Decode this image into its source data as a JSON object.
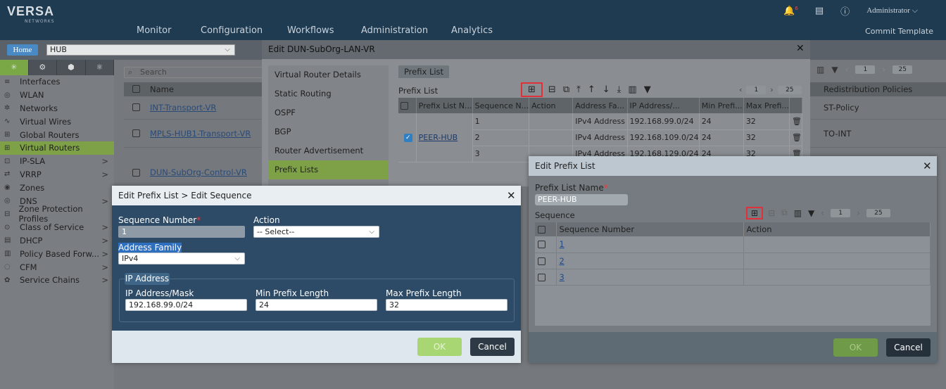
{
  "app": {
    "logo": "VERSA",
    "logo_sub": "NETWORKS",
    "nav": [
      "Monitor",
      "Configuration",
      "Workflows",
      "Administration",
      "Analytics"
    ],
    "user": "Administrator",
    "commit": "Commit Template",
    "badge": "6"
  },
  "context": {
    "home": "Home",
    "org": "HUB"
  },
  "left_nav": [
    {
      "label": "Interfaces",
      "icon": "≡",
      "arrow": ""
    },
    {
      "label": "WLAN",
      "icon": "◎",
      "arrow": ""
    },
    {
      "label": "Networks",
      "icon": "✲",
      "arrow": ""
    },
    {
      "label": "Virtual Wires",
      "icon": "∿",
      "arrow": ""
    },
    {
      "label": "Global Routers",
      "icon": "⊞",
      "arrow": ""
    },
    {
      "label": "Virtual Routers",
      "icon": "⊞",
      "arrow": "",
      "selected": true
    },
    {
      "label": "IP-SLA",
      "icon": "⊡",
      "arrow": ">"
    },
    {
      "label": "VRRP",
      "icon": "⇄",
      "arrow": ">"
    },
    {
      "label": "Zones",
      "icon": "◉",
      "arrow": ""
    },
    {
      "label": "DNS",
      "icon": "◎",
      "arrow": ">"
    },
    {
      "label": "Zone Protection Profiles",
      "icon": "⊟",
      "arrow": ""
    },
    {
      "label": "Class of Service",
      "icon": "⊙",
      "arrow": ">"
    },
    {
      "label": "DHCP",
      "icon": "▤",
      "arrow": ">"
    },
    {
      "label": "Policy Based Forw...",
      "icon": "▥",
      "arrow": ">"
    },
    {
      "label": "CFM",
      "icon": "◌",
      "arrow": ">"
    },
    {
      "label": "Service Chains",
      "icon": "✿",
      "arrow": ">"
    }
  ],
  "list": {
    "search_placeholder": "Search",
    "col_name": "Name",
    "col_redist": "Redistribution Policies",
    "rows": [
      {
        "name": "INT-Transport-VR",
        "redist": "ST-Policy"
      },
      {
        "name": "MPLS-HUB1-Transport-VR",
        "redist": "TO-INT"
      },
      {
        "name": "DUN-SubOrg-Control-VR",
        "redist": ""
      }
    ],
    "page": "1",
    "page_size": "25"
  },
  "vr_dialog": {
    "title": "Edit DUN-SubOrg-LAN-VR",
    "menu": [
      "Virtual Router Details",
      "Static Routing",
      "OSPF",
      "BGP",
      "Router Advertisement",
      "Prefix Lists"
    ],
    "tab": "Prefix List",
    "section": "Prefix List",
    "page": "1",
    "page_size": "25",
    "columns": [
      "Prefix List N...",
      "Sequence N...",
      "Action",
      "Address Fa...",
      "IP Address/...",
      "Min Prefi...",
      "Max Prefi..."
    ],
    "rows": [
      {
        "name": "",
        "seq": "1",
        "action": "",
        "family": "IPv4 Address",
        "ip": "192.168.99.0/24",
        "min": "24",
        "max": "32"
      },
      {
        "name": "PEER-HUB",
        "seq": "2",
        "action": "",
        "family": "IPv4 Address",
        "ip": "192.168.109.0/24",
        "min": "24",
        "max": "32"
      },
      {
        "name": "",
        "seq": "3",
        "action": "",
        "family": "IPv4 Address",
        "ip": "192.168.129.0/24",
        "min": "24",
        "max": "32"
      }
    ]
  },
  "seq_dialog": {
    "title": "Edit Prefix List > Edit Sequence",
    "seq_label": "Sequence Number",
    "seq_value": "1",
    "action_label": "Action",
    "action_value": "-- Select--",
    "family_label": "Address Family",
    "family_value": "IPv4",
    "ip_group": "IP Address",
    "ip_label": "IP Address/Mask",
    "ip_value": "192.168.99.0/24",
    "min_label": "Min Prefix Length",
    "min_value": "24",
    "max_label": "Max Prefix Length",
    "max_value": "32",
    "ok": "OK",
    "cancel": "Cancel"
  },
  "ep_dialog": {
    "title": "Edit Prefix List",
    "name_label": "Prefix List Name",
    "name_value": "PEER-HUB",
    "seq_label": "Sequence",
    "page": "1",
    "page_size": "25",
    "col_seq": "Sequence Number",
    "col_action": "Action",
    "rows": [
      "1",
      "2",
      "3"
    ],
    "ok": "OK",
    "cancel": "Cancel"
  }
}
